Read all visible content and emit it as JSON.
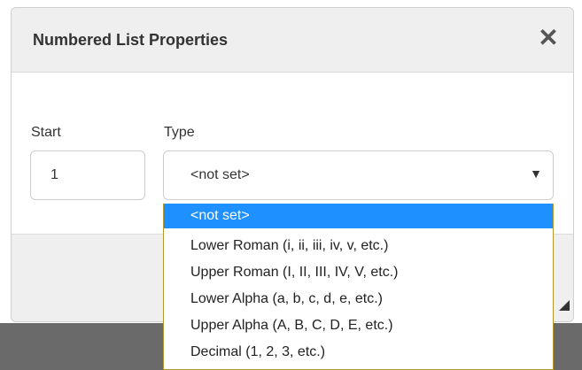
{
  "dialog": {
    "title": "Numbered List Properties",
    "close_glyph": "✕"
  },
  "fields": {
    "start_label": "Start",
    "start_value": "1",
    "type_label": "Type",
    "type_value": "<not set>",
    "chevron_glyph": "▼"
  },
  "dropdown": {
    "options": [
      "<not set>",
      "Lower Roman (i, ii, iii, iv, v, etc.)",
      "Upper Roman (I, II, III, IV, V, etc.)",
      "Lower Alpha (a, b, c, d, e, etc.)",
      "Upper Alpha (A, B, C, D, E, etc.)",
      "Decimal (1, 2, 3, etc.)"
    ],
    "selected_index": 0
  },
  "colors": {
    "highlight": "#1e90ff",
    "header_bg": "#efefef",
    "dropdown_border": "#b8962e"
  }
}
